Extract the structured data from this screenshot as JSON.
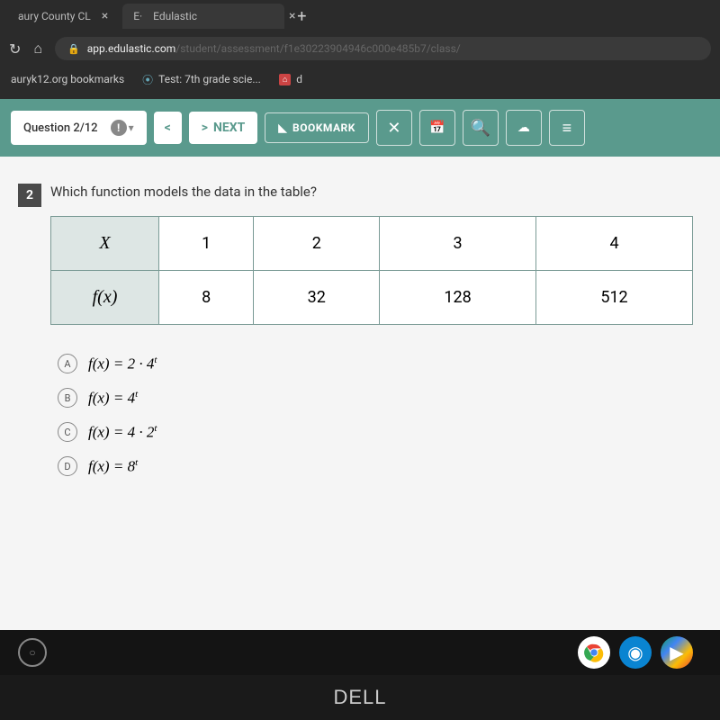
{
  "browser": {
    "tabs": [
      {
        "title": "aury County CL"
      },
      {
        "title": "Edulastic"
      }
    ],
    "url": "app.edulastic.com",
    "url_trail": "/student/assessment/f1e30223904946c000e485b7/class/",
    "bookmarks": [
      {
        "label": "auryk12.org bookmarks"
      },
      {
        "label": "Test: 7th grade scie..."
      },
      {
        "label": "d"
      }
    ]
  },
  "toolbar": {
    "question_label": "Question 2/12",
    "prev": "<",
    "next": "NEXT",
    "bookmark": "BOOKMARK"
  },
  "question": {
    "number": "2",
    "prompt": "Which function models the data in the table?",
    "table": {
      "row1_head": "X",
      "row1": [
        "1",
        "2",
        "3",
        "4"
      ],
      "row2_head": "f(x)",
      "row2": [
        "8",
        "32",
        "128",
        "512"
      ]
    },
    "choices": [
      {
        "letter": "A",
        "expr": "f(x) = 2 · 4",
        "sup": "t"
      },
      {
        "letter": "B",
        "expr": "f(x) = 4",
        "sup": "t"
      },
      {
        "letter": "C",
        "expr": "f(x) = 4 · 2",
        "sup": "t"
      },
      {
        "letter": "D",
        "expr": "f(x) = 8",
        "sup": "t"
      }
    ]
  },
  "laptop_brand": "DELL"
}
